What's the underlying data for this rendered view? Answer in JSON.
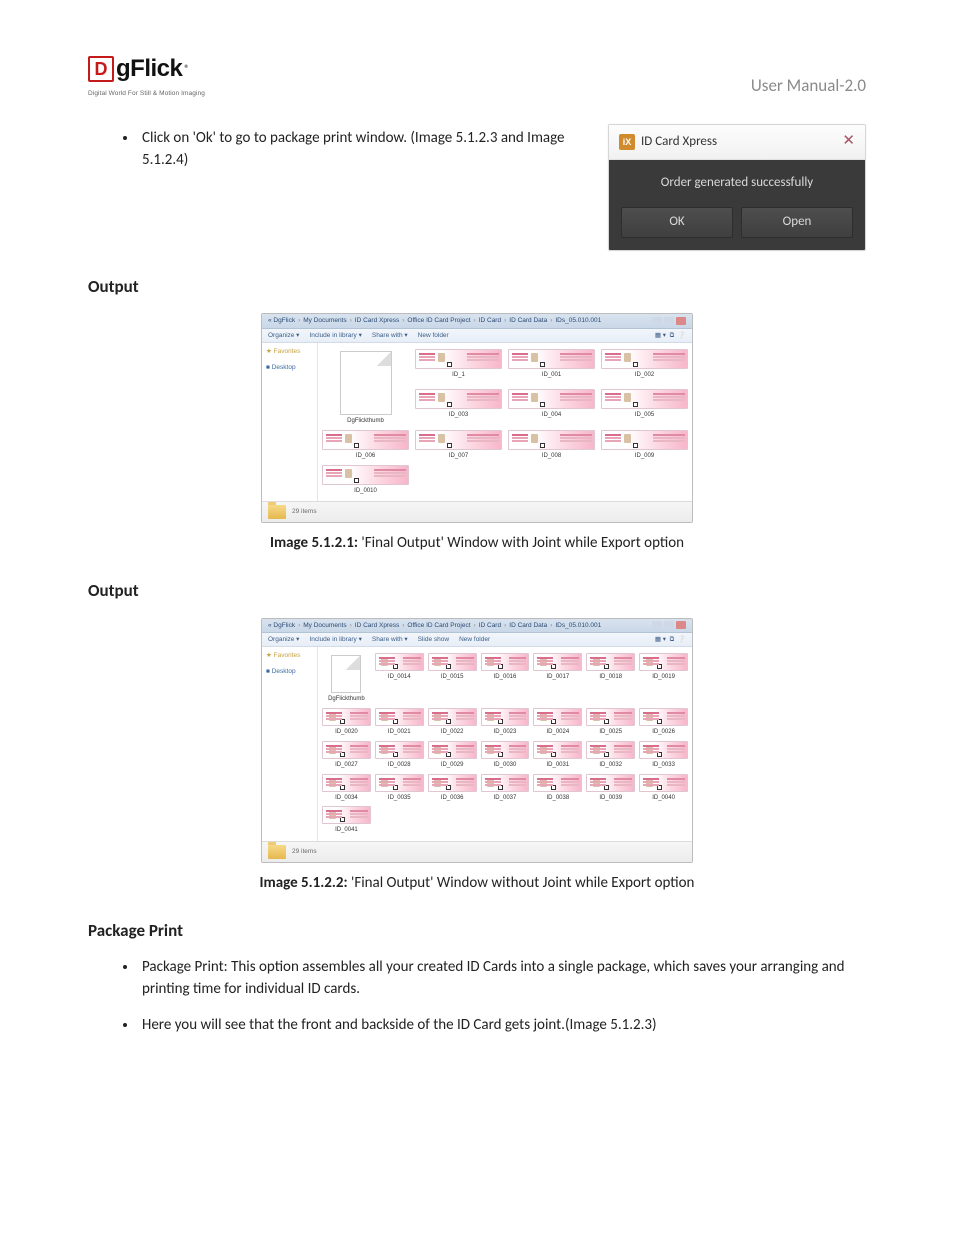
{
  "header": {
    "logo_letter": "D",
    "logo_text": "gFlick",
    "logo_reg": "®",
    "logo_tagline": "Digital World For Still & Motion Imaging",
    "right": "User Manual-2.0"
  },
  "intro_bullet": "Click on 'Ok' to go to package print window. (Image 5.1.2.3  and Image 5.1.2.4)",
  "dialog": {
    "title": "ID Card Xpress",
    "icon": "iX",
    "message": "Order generated successfully",
    "ok": "OK",
    "open": "Open"
  },
  "sections": {
    "output1": "Output",
    "output2": "Output",
    "package": "Package Print"
  },
  "explorer": {
    "breadcrumb": [
      "« DgFlick",
      "My Documents",
      "ID Card Xpress",
      "Office ID Card Project",
      "ID Card",
      "ID Card Data",
      "IDs_05.010.001"
    ],
    "toolbar": [
      "Organize ▾",
      "Include in library ▾",
      "Share with ▾",
      "Slide show",
      "New folder"
    ],
    "sidebar": {
      "favorites": "★ Favorites",
      "desktop": "■ Desktop"
    },
    "status": "29 items",
    "thumb_label": "DgFlickthumb",
    "grid1": [
      "ID_1",
      "ID_001",
      "ID_002",
      "ID_003",
      "ID_004",
      "ID_005",
      "ID_006",
      "ID_007",
      "ID_008",
      "ID_009",
      "ID_0010"
    ],
    "grid2": [
      "ID_0014",
      "ID_0015",
      "ID_0016",
      "ID_0017",
      "ID_0018",
      "ID_0019",
      "ID_0020",
      "ID_0021",
      "ID_0022",
      "ID_0023",
      "ID_0024",
      "ID_0025",
      "ID_0026",
      "ID_0027",
      "ID_0028",
      "ID_0029",
      "ID_0030",
      "ID_0031",
      "ID_0032",
      "ID_0033",
      "ID_0034",
      "ID_0035",
      "ID_0036",
      "ID_0037",
      "ID_0038",
      "ID_0039",
      "ID_0040",
      "ID_0041"
    ]
  },
  "captions": {
    "c1_bold": "Image 5.1.2.1:",
    "c1_rest": " 'Final Output' Window with Joint while Export option",
    "c2_bold": "Image 5.1.2.2:",
    "c2_rest": " 'Final Output' Window without Joint while Export option"
  },
  "package_bullets": [
    "Package Print: This option assembles all your created ID Cards into a single package, which saves your arranging and printing time for individual ID cards.",
    "Here you will see that the front and backside of the ID Card gets joint.(Image 5.1.2.3)"
  ]
}
